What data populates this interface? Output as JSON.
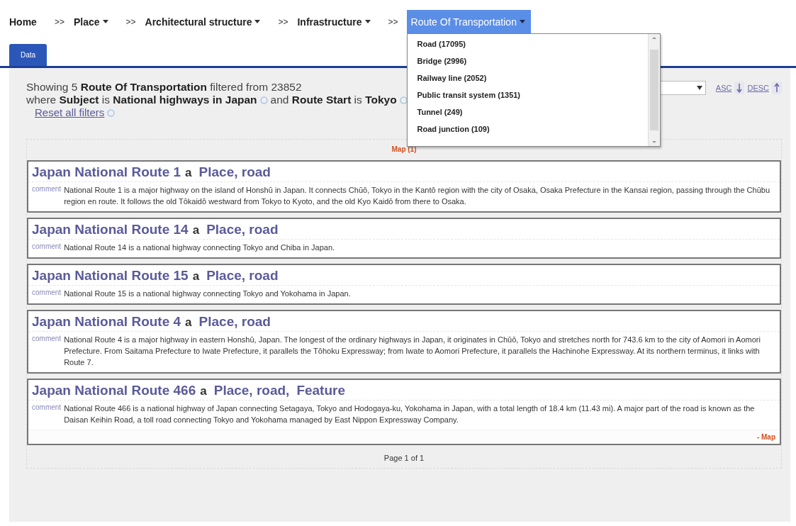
{
  "breadcrumb": [
    {
      "label": "Home",
      "dropdown": false,
      "selected": false
    },
    {
      "label": "Place",
      "dropdown": true,
      "selected": false
    },
    {
      "label": "Architectural structure",
      "dropdown": true,
      "selected": false
    },
    {
      "label": "Infrastructure",
      "dropdown": true,
      "selected": false
    },
    {
      "label": "Route Of Transportation",
      "dropdown": true,
      "selected": true
    }
  ],
  "separators": [
    ">>",
    ">>",
    ">>",
    ">>"
  ],
  "dropdown_menu": {
    "items": [
      {
        "label": "Road (17095)"
      },
      {
        "label": "Bridge (2996)"
      },
      {
        "label": "Railway line (2052)"
      },
      {
        "label": "Public transit system (1351)"
      },
      {
        "label": "Tunnel (249)"
      },
      {
        "label": "Road junction (109)"
      }
    ]
  },
  "tabs": [
    {
      "label": "Data",
      "selected": true
    }
  ],
  "summary": {
    "line1": "Showing 5 **Route Of Transportation** filtered from 23852",
    "filters": [
      "where **Subject** is **National highways in Japan**",
      "and **Route Start** is **Tokyo**"
    ],
    "reset": "Reset all filters"
  },
  "sort": {
    "asc": "ASC",
    "desc": "DESC"
  },
  "map_link": "Map (1)",
  "results": [
    {
      "title": "Japan National Route 1",
      "a": "a",
      "types": [
        "Place, road"
      ],
      "comment_label": "comment",
      "comment": "National Route 1 is a major highway on the island of Honshū in Japan. It connects Chūō, Tokyo in the Kantō region with the city of Osaka, Osaka Prefecture in the Kansai region, passing through the Chūbu region en route. It follows the old Tōkaidō westward from Tokyo to Kyoto, and the old Kyo Kaidō from there to Osaka."
    },
    {
      "title": "Japan National Route 14",
      "a": "a",
      "types": [
        "Place, road"
      ],
      "comment_label": "comment",
      "comment": "National Route 14 is a national highway connecting Tokyo and Chiba in Japan."
    },
    {
      "title": "Japan National Route 15",
      "a": "a",
      "types": [
        "Place, road"
      ],
      "comment_label": "comment",
      "comment": "National Route 15 is a national highway connecting Tokyo and Yokohama in Japan."
    },
    {
      "title": "Japan National Route 4",
      "a": "a",
      "types": [
        "Place, road"
      ],
      "comment_label": "comment",
      "comment": "National Route 4 is a major highway in eastern Honshū, Japan. The longest of the ordinary highways in Japan, it originates in Chūō, Tokyo and stretches north for 743.6 km to the city of Aomori in Aomori Prefecture. From Saitama Prefecture to Iwate Prefecture, it parallels the Tōhoku Expressway; from Iwate to Aomori Prefecture, it parallels the Hachinohe Expressway. At its northern terminus, it links with Route 7."
    },
    {
      "title": "Japan National Route 466",
      "a": "a",
      "types": [
        "Place, road,",
        "Feature"
      ],
      "comment_label": "comment",
      "comment": "National Route 466 is a national highway of Japan connecting Setagaya, Tokyo and Hodogaya-ku, Yokohama in Japan, with a total length of 18.4 km (11.43 mi). A major part of the road is known as the Daisan Keihin Road, a toll road connecting Tokyo and Yokohama managed by East Nippon Expressway Company.",
      "map_link": "- Map"
    }
  ],
  "pager": "Page 1 of 1"
}
